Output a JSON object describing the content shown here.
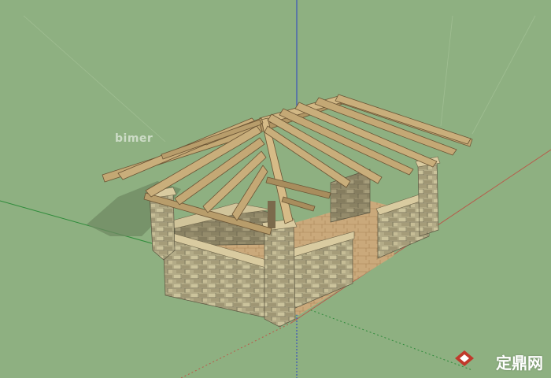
{
  "watermark_top": "bimer",
  "watermark_bottom": "定鼎网",
  "colors": {
    "background": "#8eb081",
    "axis_red": "#b85a4a",
    "axis_green": "#2e8b3a",
    "axis_blue": "#2b3fc7",
    "stone": "#b5ad88",
    "stone_dark": "#8e8563",
    "wood": "#b99e6e",
    "wood_dark": "#8b7148",
    "floor": "#c9a97a"
  },
  "icons": {
    "logo": "diamond-logo-icon"
  }
}
